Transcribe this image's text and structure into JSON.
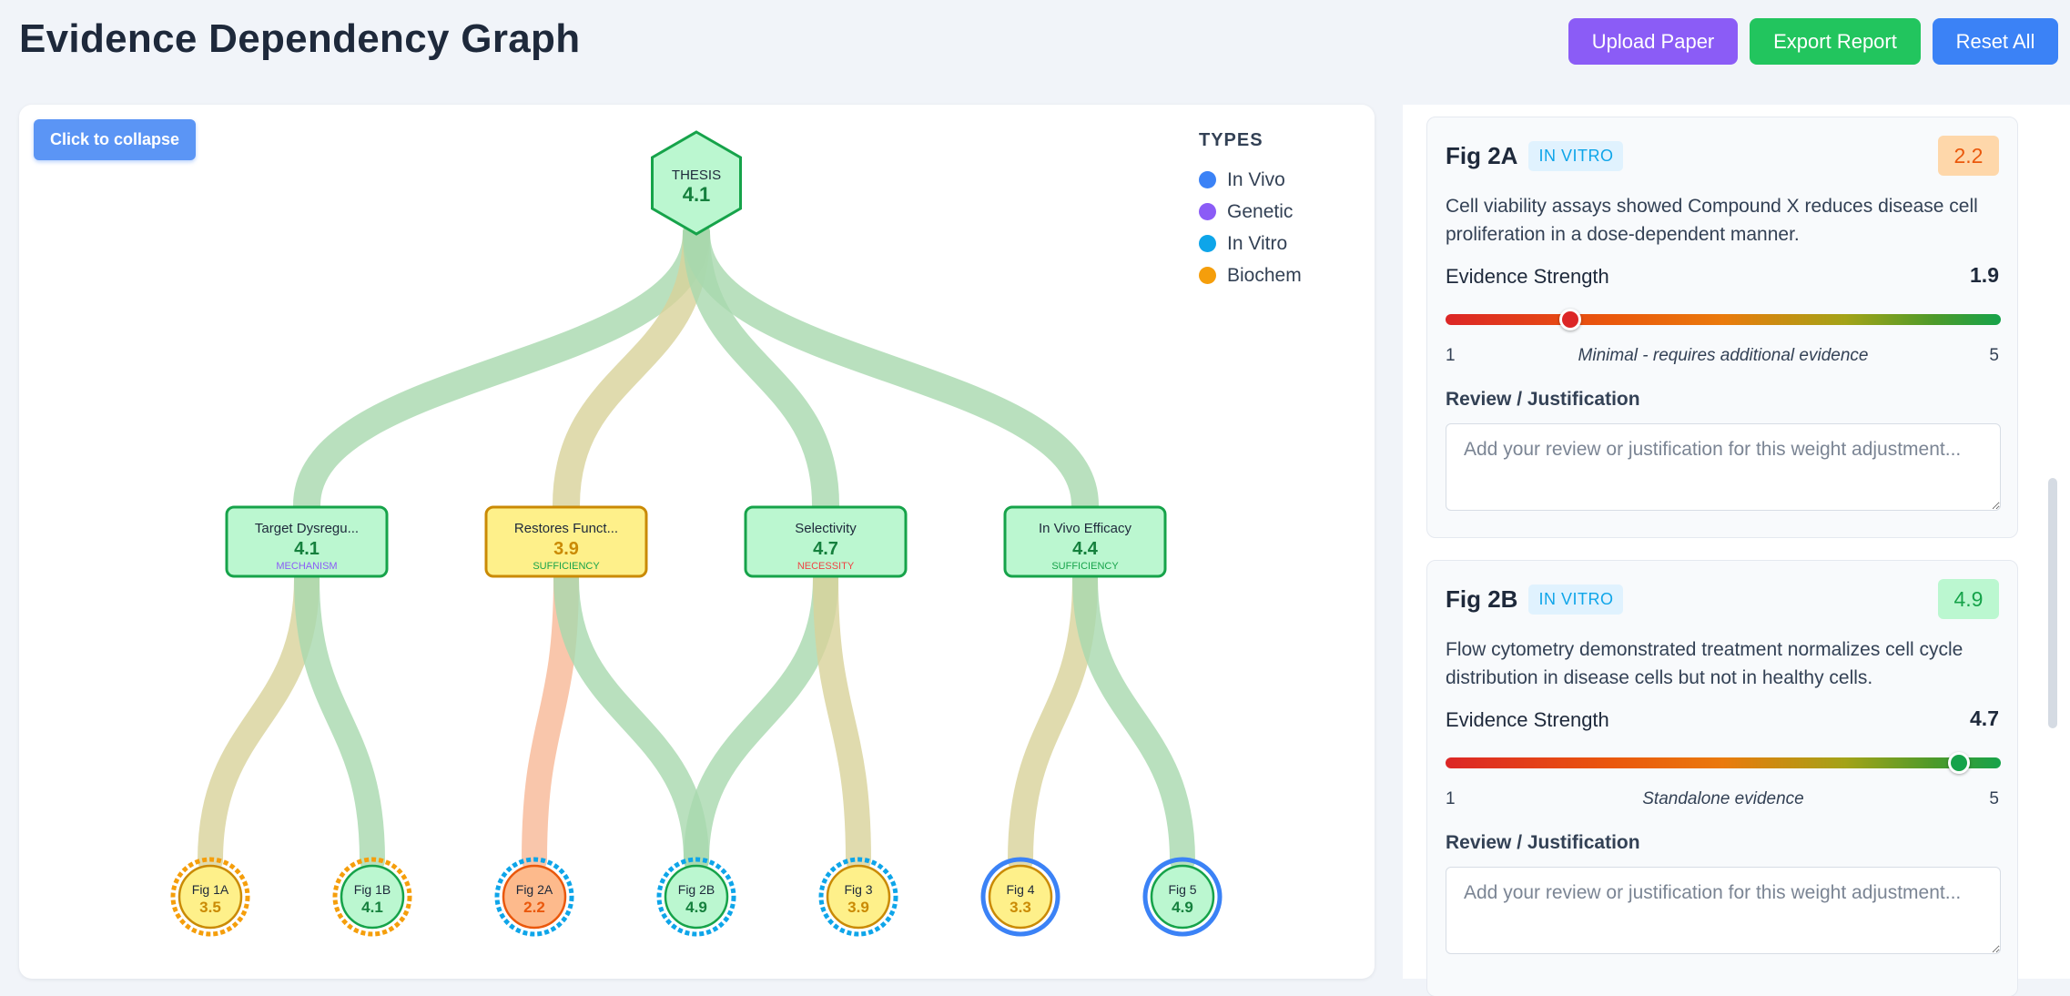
{
  "header": {
    "title": "Evidence Dependency Graph",
    "upload_label": "Upload Paper",
    "export_label": "Export Report",
    "reset_label": "Reset All"
  },
  "graph": {
    "collapse_label": "Click to collapse",
    "legend": {
      "title": "TYPES",
      "items": [
        {
          "label": "In Vivo",
          "color": "#3b82f6"
        },
        {
          "label": "Genetic",
          "color": "#8b5cf6"
        },
        {
          "label": "In Vitro",
          "color": "#0ea5e9"
        },
        {
          "label": "Biochem",
          "color": "#f59e0b"
        }
      ]
    },
    "thesis": {
      "label": "THESIS",
      "score": "4.1"
    },
    "claims": [
      {
        "id": "c1",
        "label": "Target Dysregu...",
        "score": "4.1",
        "tag": "MECHANISM",
        "level": "high"
      },
      {
        "id": "c2",
        "label": "Restores Funct...",
        "score": "3.9",
        "tag": "SUFFICIENCY",
        "level": "mid"
      },
      {
        "id": "c3",
        "label": "Selectivity",
        "score": "4.7",
        "tag": "NECESSITY",
        "level": "high"
      },
      {
        "id": "c4",
        "label": "In Vivo Efficacy",
        "score": "4.4",
        "tag": "SUFFICIENCY",
        "level": "high"
      }
    ],
    "figures": [
      {
        "id": "f1a",
        "label": "Fig 1A",
        "score": "3.5",
        "type": "biochem",
        "level": "mid"
      },
      {
        "id": "f1b",
        "label": "Fig 1B",
        "score": "4.1",
        "type": "biochem",
        "level": "high"
      },
      {
        "id": "f2a",
        "label": "Fig 2A",
        "score": "2.2",
        "type": "invitro",
        "level": "low"
      },
      {
        "id": "f2b",
        "label": "Fig 2B",
        "score": "4.9",
        "type": "invitro",
        "level": "high"
      },
      {
        "id": "f3",
        "label": "Fig 3",
        "score": "3.9",
        "type": "invitro",
        "level": "mid"
      },
      {
        "id": "f4",
        "label": "Fig 4",
        "score": "3.3",
        "type": "invivo",
        "level": "mid"
      },
      {
        "id": "f5",
        "label": "Fig 5",
        "score": "4.9",
        "type": "invivo",
        "level": "high"
      }
    ],
    "links": [
      {
        "from": "f1a",
        "to": "c1"
      },
      {
        "from": "f1b",
        "to": "c1"
      },
      {
        "from": "f2a",
        "to": "c2"
      },
      {
        "from": "f2b",
        "to": "c2"
      },
      {
        "from": "f2b",
        "to": "c3"
      },
      {
        "from": "f3",
        "to": "c3"
      },
      {
        "from": "f4",
        "to": "c4"
      },
      {
        "from": "f5",
        "to": "c4"
      }
    ],
    "colors": {
      "high_fill": "#bbf7d0",
      "high_stroke": "#16a34a",
      "high_text": "#15803d",
      "mid_fill": "#fef08a",
      "mid_stroke": "#ca8a04",
      "mid_text": "#ca8a04",
      "low_fill": "#fdba8c",
      "low_stroke": "#ea580c",
      "low_text": "#ea580c",
      "link_high": "#a7d8ae",
      "link_mid": "#d8d29a",
      "link_low": "#f7b896",
      "tag_mechanism": "#8b5cf6",
      "tag_sufficiency": "#16a34a",
      "tag_necessity": "#ef4444"
    }
  },
  "cards": [
    {
      "name": "Fig 2A",
      "type": "IN VITRO",
      "score": "2.2",
      "description": "Cell viability assays showed Compound X reduces disease cell proliferation in a dose-dependent manner.",
      "strength_label": "Evidence Strength",
      "strength": "1.9",
      "strength_value": 1.9,
      "thumb_color": "#dc2626",
      "scale_min": "1",
      "scale_max": "5",
      "scale_note": "Minimal - requires additional evidence",
      "review_label": "Review / Justification",
      "review_placeholder": "Add your review or justification for this weight adjustment...",
      "review_value": ""
    },
    {
      "name": "Fig 2B",
      "type": "IN VITRO",
      "score": "4.9",
      "description": "Flow cytometry demonstrated treatment normalizes cell cycle distribution in disease cells but not in healthy cells.",
      "strength_label": "Evidence Strength",
      "strength": "4.7",
      "strength_value": 4.7,
      "thumb_color": "#16a34a",
      "scale_min": "1",
      "scale_max": "5",
      "scale_note": "Standalone evidence",
      "review_label": "Review / Justification",
      "review_placeholder": "Add your review or justification for this weight adjustment...",
      "review_value": ""
    }
  ]
}
